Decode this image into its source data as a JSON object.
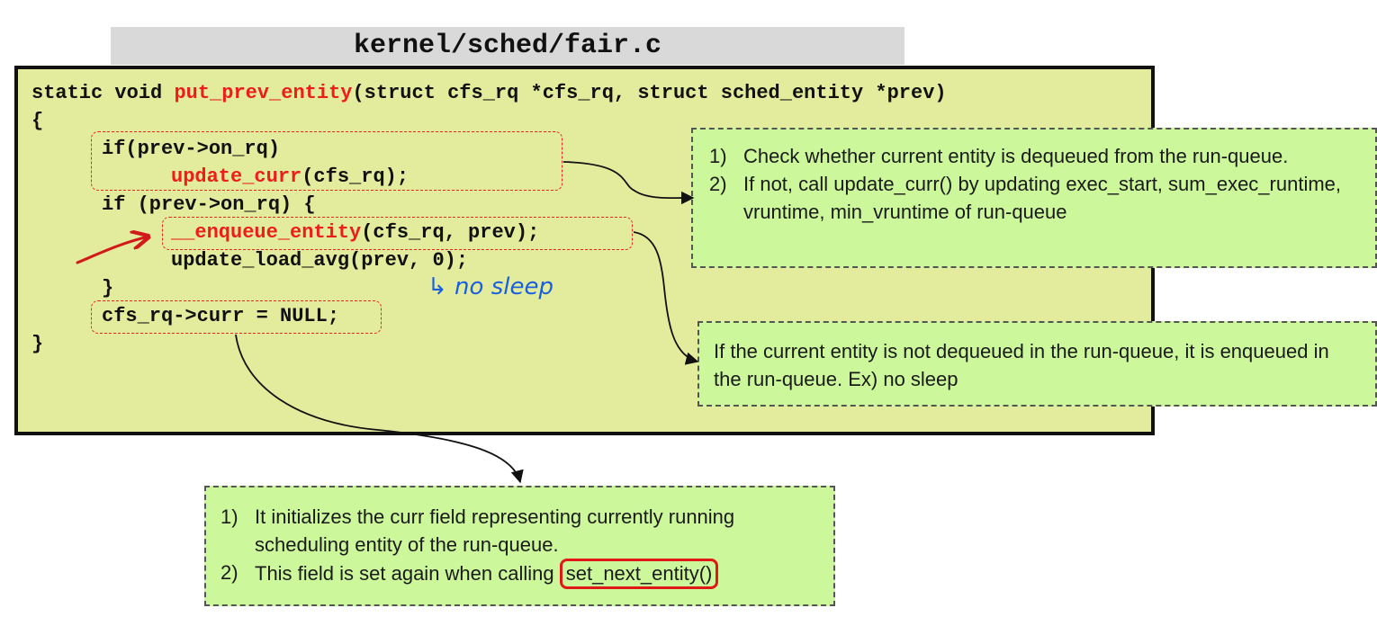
{
  "title": "kernel/sched/fair.c",
  "code": {
    "line1_pre": "static void ",
    "line1_fn": "put_prev_entity",
    "line1_post": "(struct cfs_rq *cfs_rq, struct sched_entity *prev)",
    "line2": "{",
    "line3": "if(prev->on_rq)",
    "line4_fn": "update_curr",
    "line4_post": "(cfs_rq);",
    "line5": "if (prev->on_rq) {",
    "line6_fn": "__enqueue_entity",
    "line6_post": "(cfs_rq, prev);",
    "line7": "update_load_avg(prev, 0);",
    "line8": "}",
    "line9": "cfs_rq->curr = NULL;",
    "line10": "}"
  },
  "handwritten_note": "↳ no sleep",
  "note1": {
    "items": [
      {
        "num": "1)",
        "text": "Check whether current entity is dequeued from the run-queue."
      },
      {
        "num": "2)",
        "text": "If not, call update_curr() by updating exec_start, sum_exec_runtime, vruntime, min_vruntime of run-queue"
      }
    ]
  },
  "note2": {
    "text": "If the current entity is not dequeued in the run-queue, it is enqueued in the run-queue. Ex) no sleep"
  },
  "note3": {
    "item1_num": "1)",
    "item1_text": "It initializes the curr field representing currently running scheduling entity of the run-queue.",
    "item2_num": "2)",
    "item2_text": "This field is set again when calling ",
    "item2_circled": "set_next_entity()"
  },
  "colors": {
    "code_bg": "#e3ec9d",
    "note_bg": "#ccf79a",
    "highlight_red": "#ee1c1c",
    "handwriting_blue": "#1a5fe0"
  }
}
